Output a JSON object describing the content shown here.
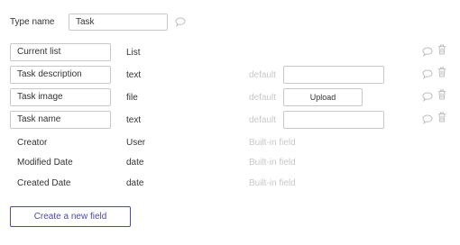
{
  "type_name": {
    "label": "Type name",
    "value": "Task",
    "comment_icon": "speech-bubble-icon"
  },
  "fields": [
    {
      "name": "Current list",
      "type": "List",
      "editable": true,
      "default_label": "",
      "default_kind": "none"
    },
    {
      "name": "Task description",
      "type": "text",
      "editable": true,
      "default_label": "default",
      "default_kind": "input"
    },
    {
      "name": "Task image",
      "type": "file",
      "editable": true,
      "default_label": "default",
      "default_kind": "upload",
      "upload_label": "Upload"
    },
    {
      "name": "Task name",
      "type": "text",
      "editable": true,
      "default_label": "default",
      "default_kind": "input"
    }
  ],
  "builtin_fields": [
    {
      "name": "Creator",
      "type": "User",
      "note": "Built-in field"
    },
    {
      "name": "Modified Date",
      "type": "date",
      "note": "Built-in field"
    },
    {
      "name": "Created Date",
      "type": "date",
      "note": "Built-in field"
    }
  ],
  "icons": {
    "comment": "speech-bubble-icon",
    "delete": "trash-icon"
  },
  "colors": {
    "border": "#c8c8c8",
    "muted_text": "#c8c8c8",
    "accent": "#4a4ab0",
    "icon": "#c0c0c0"
  },
  "create_button": {
    "label": "Create a new field"
  }
}
